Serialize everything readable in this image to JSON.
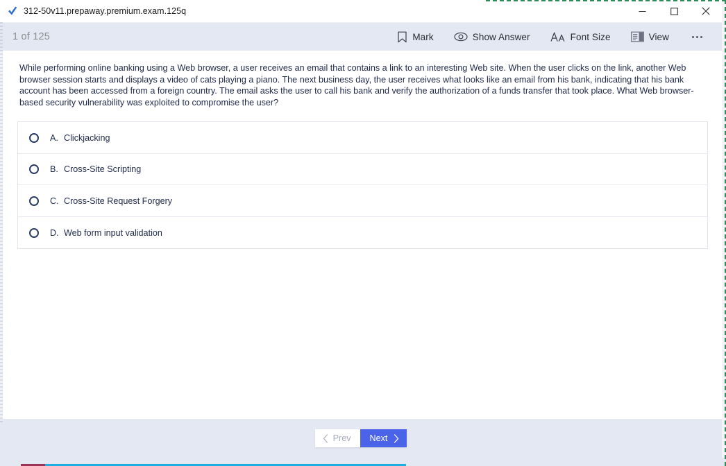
{
  "window": {
    "title": "312-50v11.prepaway.premium.exam.125q",
    "app_icon": "blue-check-icon",
    "controls": {
      "minimize": "minimize-icon",
      "maximize": "maximize-icon",
      "close": "close-icon"
    }
  },
  "toolbar": {
    "counter": "1 of 125",
    "buttons": [
      {
        "label": "Mark",
        "icon": "bookmark-icon"
      },
      {
        "label": "Show Answer",
        "icon": "eye-icon"
      },
      {
        "label": "Font Size",
        "icon": "font-size-icon"
      },
      {
        "label": "View",
        "icon": "view-layout-icon"
      }
    ],
    "overflow": "more-options-icon"
  },
  "question": {
    "text": "While performing online banking using a Web browser, a user receives an email that contains a link to an interesting Web site. When the user clicks on the link, another Web browser session starts and displays a video of cats playing a piano. The next business day, the user receives what looks like an email from his bank, indicating that his bank account has been accessed from a foreign country. The email asks the user to call his bank and verify the authorization of a funds transfer that took place. What Web browser-based security vulnerability was exploited to compromise the user?",
    "options": [
      {
        "letter": "A.",
        "text": "Clickjacking",
        "selected": false
      },
      {
        "letter": "B.",
        "text": "Cross-Site Scripting",
        "selected": false
      },
      {
        "letter": "C.",
        "text": "Cross-Site Request Forgery",
        "selected": false
      },
      {
        "letter": "D.",
        "text": "Web form input validation",
        "selected": false
      }
    ]
  },
  "footer": {
    "prev_label": "Prev",
    "next_label": "Next",
    "prev_enabled": false,
    "next_enabled": true
  },
  "colors": {
    "accent": "#4a63e8",
    "toolbar_bg": "#e4e8f2",
    "text": "#1f2a4a",
    "muted": "#8e8e93"
  }
}
